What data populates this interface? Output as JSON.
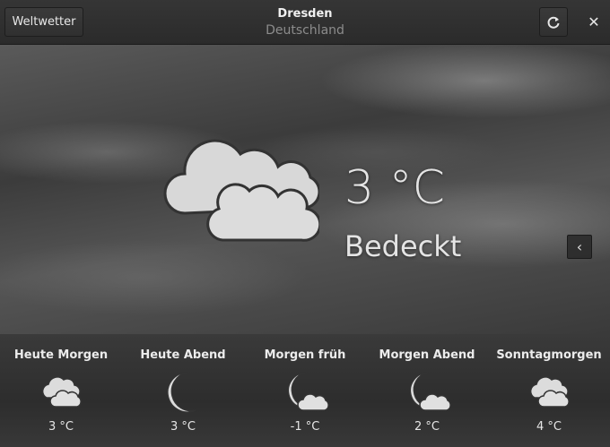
{
  "header": {
    "back_label": "Weltwetter",
    "city": "Dresden",
    "country": "Deutschland",
    "refresh_icon": "refresh-icon",
    "close_icon": "close-icon"
  },
  "current": {
    "temperature": "3 °C",
    "condition": "Bedeckt",
    "icon": "overcast-clouds-icon"
  },
  "forecast": [
    {
      "label": "Heute Morgen",
      "icon": "clouds-icon",
      "temp": "3 °C"
    },
    {
      "label": "Heute Abend",
      "icon": "crescent-moon-icon",
      "temp": "3 °C"
    },
    {
      "label": "Morgen früh",
      "icon": "moon-clouds-icon",
      "temp": "-1 °C"
    },
    {
      "label": "Morgen Abend",
      "icon": "moon-clouds-icon",
      "temp": "2 °C"
    },
    {
      "label": "Sonntagmorgen",
      "icon": "clouds-icon",
      "temp": "4 °C"
    }
  ]
}
